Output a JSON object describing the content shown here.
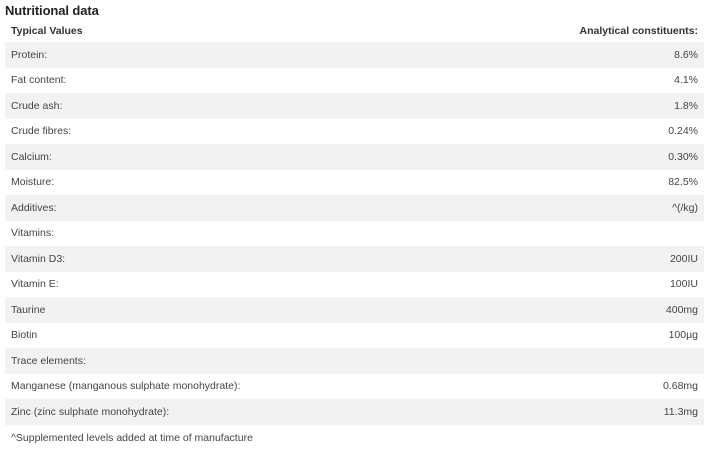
{
  "title": "Nutritional data",
  "table": {
    "header": {
      "left": "Typical Values",
      "right": "Analytical constituents:"
    },
    "rows": [
      {
        "label": "Protein:",
        "value": "8.6%"
      },
      {
        "label": "Fat content:",
        "value": "4.1%"
      },
      {
        "label": "Crude ash:",
        "value": "1.8%"
      },
      {
        "label": "Crude fibres:",
        "value": "0.24%"
      },
      {
        "label": "Calcium:",
        "value": "0.30%"
      },
      {
        "label": "Moisture:",
        "value": "82.5%"
      },
      {
        "label": "Additives:",
        "value": "^(/kg)"
      },
      {
        "label": "Vitamins:",
        "value": ""
      },
      {
        "label": "Vitamin D3:",
        "value": "200IU"
      },
      {
        "label": "Vitamin E:",
        "value": "100IU"
      },
      {
        "label": "Taurine",
        "value": "400mg"
      },
      {
        "label": "Biotin",
        "value": "100µg"
      },
      {
        "label": "Trace elements:",
        "value": ""
      },
      {
        "label": "Manganese (manganous sulphate monohydrate):",
        "value": "0.68mg"
      },
      {
        "label": "Zinc (zinc sulphate monohydrate):",
        "value": "11.3mg"
      }
    ]
  },
  "footnote": "^Supplemented levels added at time of manufacture"
}
